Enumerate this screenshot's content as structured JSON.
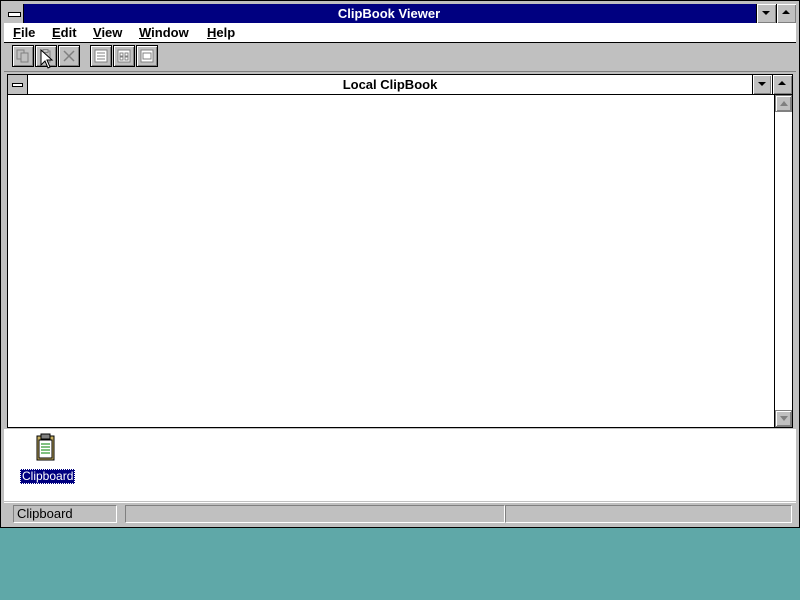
{
  "window": {
    "title": "ClipBook Viewer"
  },
  "menu": {
    "items": [
      "File",
      "Edit",
      "View",
      "Window",
      "Help"
    ]
  },
  "toolbar": {
    "buttons": [
      {
        "icon": "copy-icon"
      },
      {
        "icon": "paste-icon"
      },
      {
        "icon": "delete-icon"
      },
      {
        "icon": "table-of-contents-icon"
      },
      {
        "icon": "thumbnails-icon"
      },
      {
        "icon": "full-page-icon"
      }
    ]
  },
  "child_window": {
    "title": "Local ClipBook"
  },
  "icons": [
    {
      "label": "Clipboard",
      "icon": "clipboard-icon",
      "selected": true
    }
  ],
  "status": {
    "panes": [
      "Clipboard",
      "",
      ""
    ]
  },
  "colors": {
    "title_active": "#000080",
    "desktop": "#5fa8a8",
    "face": "#c0c0c0"
  }
}
